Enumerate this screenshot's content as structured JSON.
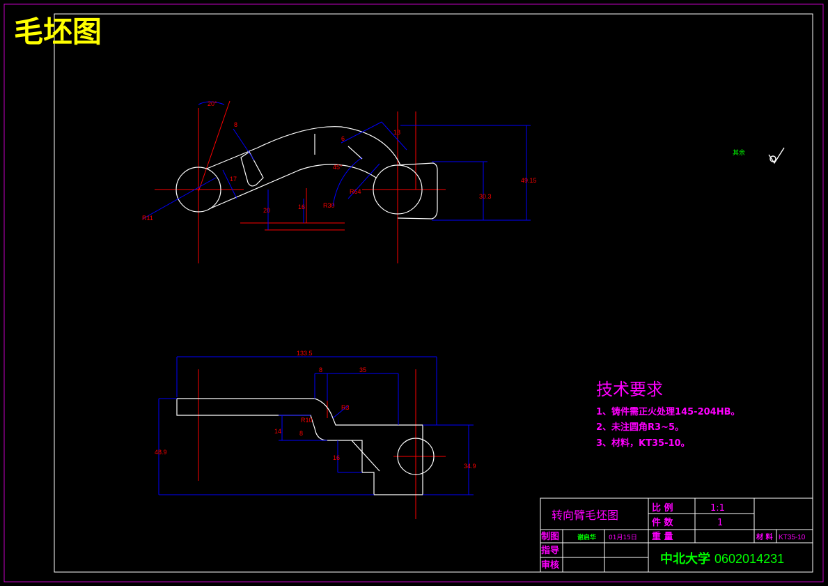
{
  "drawing": {
    "title": "毛坯图",
    "accent_colors": {
      "background": "#000000",
      "outline": "#ffffff",
      "centerline": "#ff0000",
      "dimension": "#0000ff",
      "dimtext": "#ff0000",
      "frame": "#c000c0",
      "title": "#ffff00",
      "notes": "#ff00ff",
      "green": "#00ff00"
    }
  },
  "top_view": {
    "dims": {
      "angle": "20°",
      "d8": "8",
      "d6": "6",
      "d18": "18",
      "d17": "17",
      "r11": "R11",
      "d20": "20",
      "d16": "16",
      "r30": "R30",
      "a45": "45°",
      "r64": "R64",
      "d30_3": "30.3",
      "d49_15": "49.15"
    }
  },
  "front_view": {
    "dims": {
      "d133_5": "133.5",
      "d8": "8",
      "d35": "35",
      "r3": "R3",
      "r10": "R10",
      "d14": "14",
      "d8b": "8",
      "d16": "16",
      "d48_9": "48.9",
      "d34_9": "34.9"
    }
  },
  "surface_mark": {
    "label": "其余"
  },
  "tech_requirements": {
    "heading": "技术要求",
    "items": [
      "1、铸件需正火处理145-204HB。",
      "2、未注圆角R3~5。",
      "3、材料，KT35-10。"
    ]
  },
  "title_block": {
    "part_name": "转向臂毛坯图",
    "scale_label": "比 例",
    "scale_value": "1:1",
    "qty_label": "件 数",
    "qty_value": "1",
    "weight_label": "重 量",
    "material_label": "材 料",
    "material_value": "KT35-10",
    "drawn_label": "制图",
    "drawn_name": "谢启华",
    "drawn_date": "01月15日",
    "guide_label": "指导",
    "review_label": "审核",
    "school": "中北大学",
    "student_id": "0602014231"
  }
}
